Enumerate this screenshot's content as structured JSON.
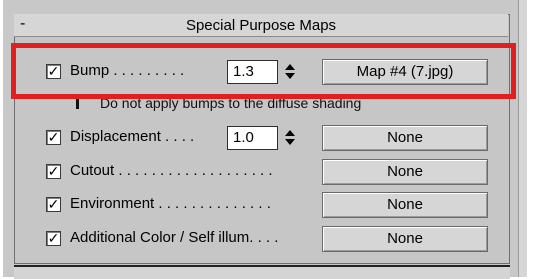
{
  "rollout": {
    "title": "Special Purpose Maps",
    "collapse_symbol": "-"
  },
  "rows": [
    {
      "label": "Bump . . . . . . . . .",
      "checked": true,
      "spinner_value": "1.3",
      "map": "Map #4 (7.jpg)"
    },
    {
      "label": "Displacement . . . .",
      "checked": true,
      "spinner_value": "1.0",
      "map": "None"
    },
    {
      "label": "Cutout . . . . . . . . . . . . . . . . . . .",
      "checked": true,
      "map": "None"
    },
    {
      "label": "Environment . . . . . . . . . . . . . .",
      "checked": true,
      "map": "None"
    },
    {
      "label": "Additional Color / Self illum. . . .",
      "checked": true,
      "map": "None"
    }
  ],
  "note": "Do not apply bumps to the diffuse shading",
  "checkmark": "✓",
  "colors": {
    "panel": "#c6c6c6",
    "button": "#d6d6d6",
    "highlight": "#e02020"
  }
}
